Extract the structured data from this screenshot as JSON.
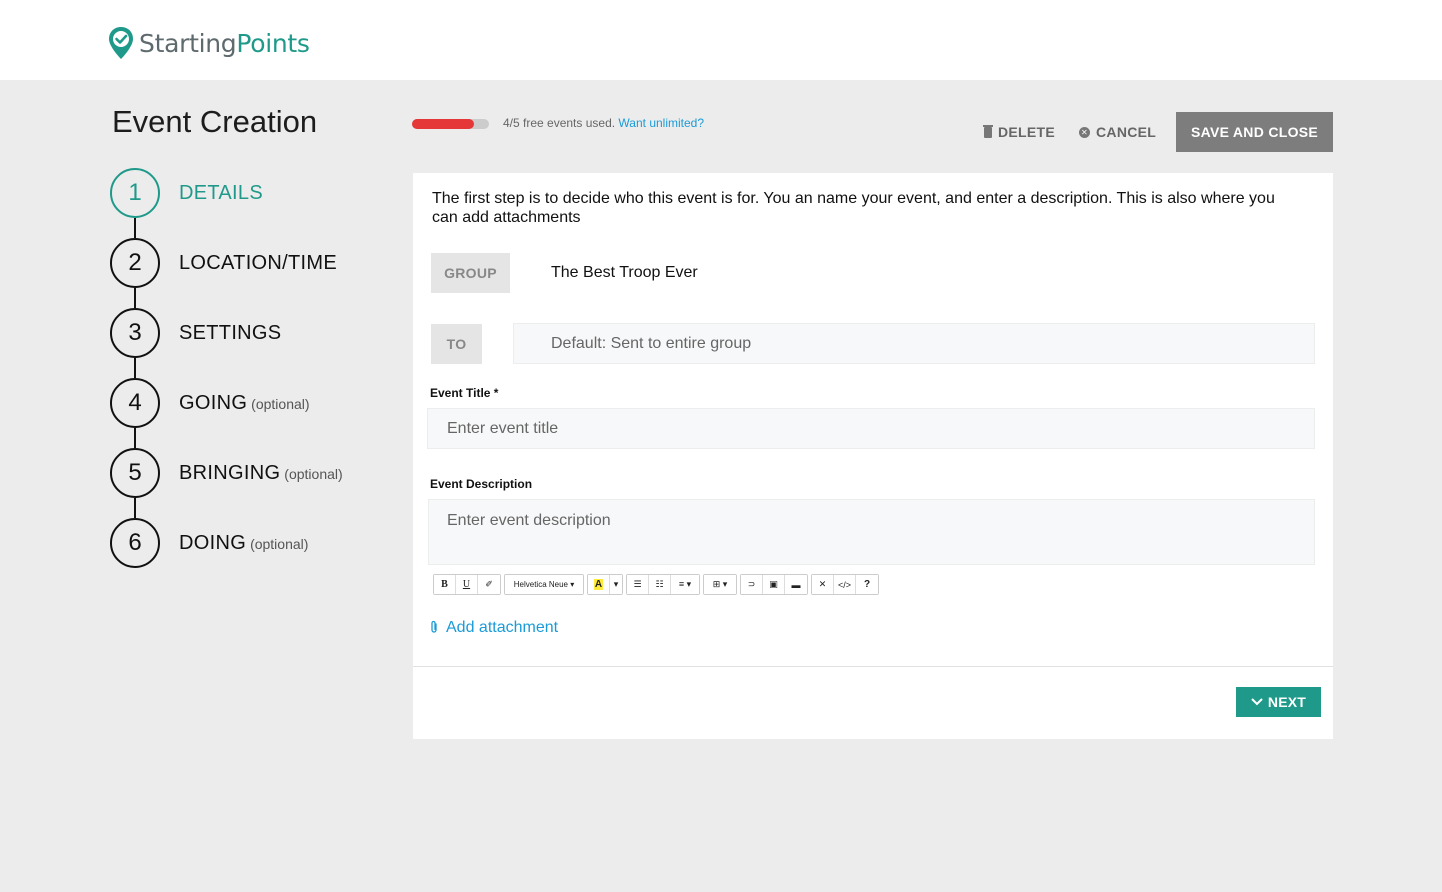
{
  "header": {
    "logo_part1": "Starting",
    "logo_part2": "Points",
    "brand_color": "#1f9a8a"
  },
  "page": {
    "title": "Event Creation"
  },
  "steps": [
    {
      "number": "1",
      "label": "DETAILS",
      "optional": "",
      "active": true
    },
    {
      "number": "2",
      "label": "LOCATION/TIME",
      "optional": "",
      "active": false
    },
    {
      "number": "3",
      "label": "SETTINGS",
      "optional": "",
      "active": false
    },
    {
      "number": "4",
      "label": "GOING",
      "optional": "(optional)",
      "active": false
    },
    {
      "number": "5",
      "label": "BRINGING",
      "optional": "(optional)",
      "active": false
    },
    {
      "number": "6",
      "label": "DOING",
      "optional": "(optional)",
      "active": false
    }
  ],
  "usage": {
    "used": 4,
    "total": 5,
    "progress_fraction": 0.8,
    "bar_color": "#e53638",
    "text": "4/5 free events used.",
    "link": "Want unlimited?"
  },
  "actions": {
    "delete": "DELETE",
    "delete_icon": "trash-icon",
    "cancel": "CANCEL",
    "cancel_icon": "close-circle-icon",
    "save": "SAVE AND CLOSE"
  },
  "form": {
    "intro": "The first step is to decide who this event is for. You an name your event, and enter a description. This is also where you can add attachments",
    "group_tag": "GROUP",
    "group_value": "The Best Troop Ever",
    "to_tag": "TO",
    "to_placeholder": "Default: Sent to entire group",
    "title_label": "Event Title *",
    "title_placeholder": "Enter event title",
    "desc_label": "Event Description",
    "desc_placeholder": "Enter event description",
    "toolbar": {
      "bold": "B",
      "underline": "U",
      "eraser": "✐",
      "font": "Helvetica Neue ▾",
      "highlight": "A",
      "caret": "▾",
      "ul": "☰",
      "ol": "☷",
      "align": "≡ ▾",
      "table": "⊞ ▾",
      "link": "⊃",
      "image": "▣",
      "video": "▬",
      "fullscreen": "✕",
      "code": "</>",
      "help": "?"
    },
    "attach": "Add attachment",
    "next": "NEXT"
  }
}
